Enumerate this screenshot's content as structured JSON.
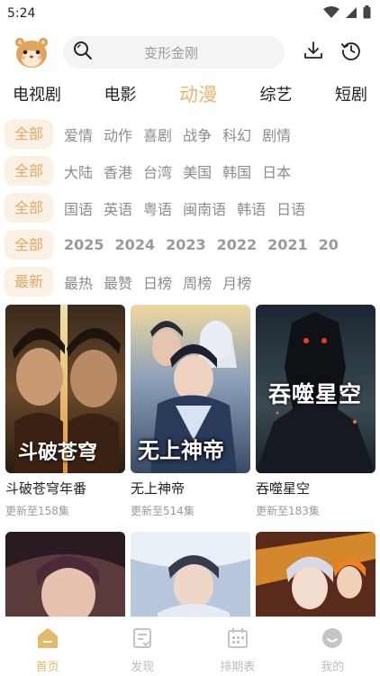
{
  "status": {
    "time": "5:24"
  },
  "search": {
    "placeholder": "变形金刚"
  },
  "category_tabs": [
    {
      "label": "电视剧",
      "active": false
    },
    {
      "label": "电影",
      "active": false
    },
    {
      "label": "动漫",
      "active": true
    },
    {
      "label": "综艺",
      "active": false
    },
    {
      "label": "短剧",
      "active": false
    }
  ],
  "filters": {
    "genre": {
      "first": "全部",
      "items": [
        "爱情",
        "动作",
        "喜剧",
        "战争",
        "科幻",
        "剧情"
      ]
    },
    "region": {
      "first": "全部",
      "items": [
        "大陆",
        "香港",
        "台湾",
        "美国",
        "韩国",
        "日本"
      ]
    },
    "language": {
      "first": "全部",
      "items": [
        "国语",
        "英语",
        "粤语",
        "闽南语",
        "韩语",
        "日语"
      ]
    },
    "year": {
      "first": "全部",
      "items": [
        "2025",
        "2024",
        "2023",
        "2022",
        "2021",
        "20"
      ]
    },
    "sort": {
      "first": "最新",
      "items": [
        "最热",
        "最赞",
        "日榜",
        "周榜",
        "月榜"
      ]
    }
  },
  "cards": [
    {
      "title": "斗破苍穹年番",
      "subtitle": "更新至158集",
      "poster_text": "斗破苍穹"
    },
    {
      "title": "无上神帝",
      "subtitle": "更新至514集",
      "poster_text": "无上神帝"
    },
    {
      "title": "吞噬星空",
      "subtitle": "更新至183集",
      "poster_text": "吞噬星空"
    }
  ],
  "bottom_nav": [
    {
      "label": "首页",
      "active": true
    },
    {
      "label": "发现",
      "active": false
    },
    {
      "label": "排期表",
      "active": false
    },
    {
      "label": "我的",
      "active": false
    }
  ],
  "colors": {
    "accent": "#e6b86c",
    "chip_bg": "#faf1e4",
    "chip_text": "#e3a866",
    "muted": "#8c8c8c"
  }
}
